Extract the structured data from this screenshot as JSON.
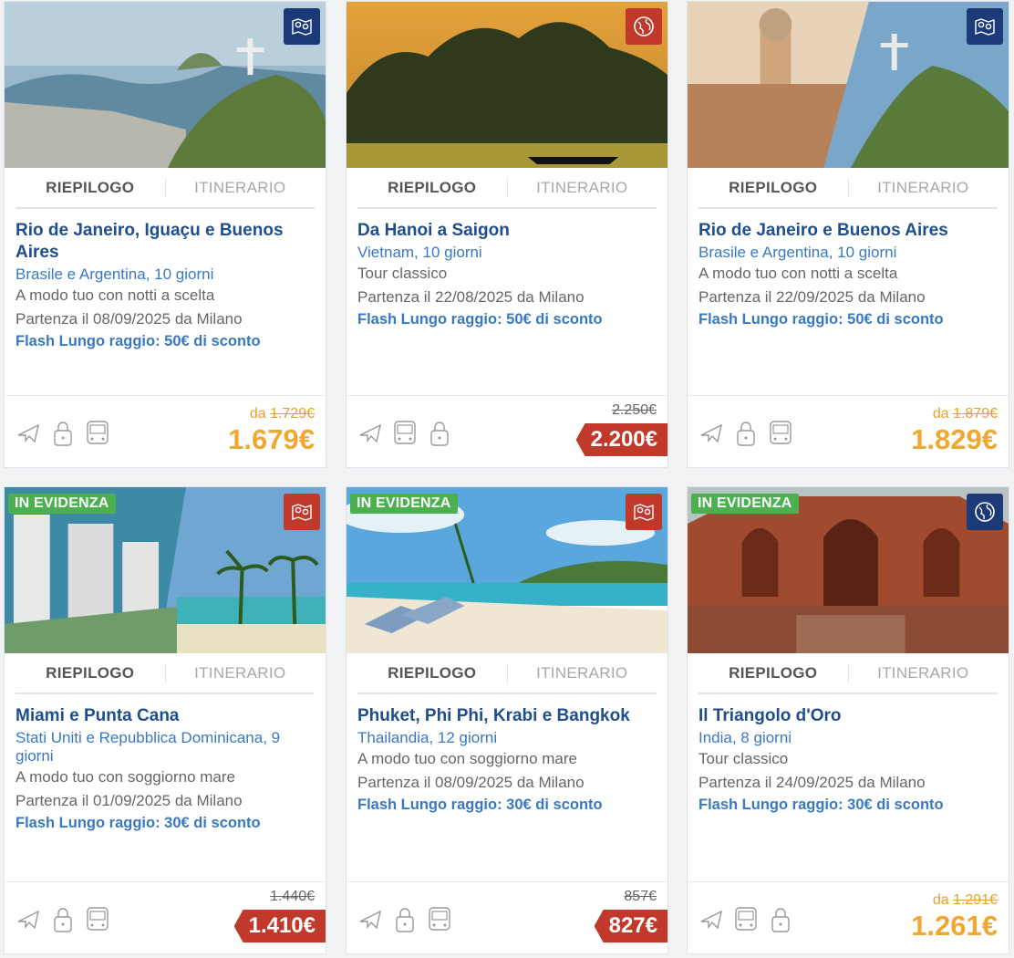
{
  "tabs": {
    "summary": "RIEPILOGO",
    "itinerary": "ITINERARIO"
  },
  "featured_label": "IN EVIDENZA",
  "cards": [
    {
      "title": "Rio de Janeiro, Iguaçu e Buenos Aires",
      "destination": "Brasile e Argentina, 10 giorni",
      "formula": "A modo tuo con notti a scelta",
      "departure": "Partenza il 08/09/2025 da Milano",
      "promo": "Flash Lungo raggio: 50€ di sconto",
      "da_label": "da",
      "old_price": "1.729€",
      "price": "1.679€",
      "price_style": "orange",
      "badge_icon": "map-pin-icon",
      "badge_color": "#1d3a78",
      "services": [
        "plane-icon",
        "lock-icon",
        "bus-icon"
      ]
    },
    {
      "title": "Da Hanoi a Saigon",
      "destination": "Vietnam, 10 giorni",
      "formula": "Tour classico",
      "departure": "Partenza il 22/08/2025 da Milano",
      "promo": "Flash Lungo raggio: 50€ di sconto",
      "old_price": "2.250€",
      "price": "2.200€",
      "price_style": "red",
      "badge_icon": "globe-icon",
      "badge_color": "#c0392b",
      "services": [
        "plane-icon",
        "bus-icon",
        "lock-icon"
      ]
    },
    {
      "title": "Rio de Janeiro e Buenos Aires",
      "destination": "Brasile e Argentina, 10 giorni",
      "formula": "A modo tuo con notti a scelta",
      "departure": "Partenza il 22/09/2025 da Milano",
      "promo": "Flash Lungo raggio: 50€ di sconto",
      "da_label": "da",
      "old_price": "1.879€",
      "price": "1.829€",
      "price_style": "orange",
      "badge_icon": "map-pin-icon",
      "badge_color": "#1d3a78",
      "services": [
        "plane-icon",
        "lock-icon",
        "bus-icon"
      ]
    },
    {
      "title": "Miami e Punta Cana",
      "destination": "Stati Uniti e Repubblica Dominicana, 9 giorni",
      "formula": "A modo tuo con soggiorno mare",
      "departure": "Partenza il 01/09/2025 da Milano",
      "promo": "Flash Lungo raggio: 30€ di sconto",
      "old_price": "1.440€",
      "price": "1.410€",
      "price_style": "red",
      "badge_icon": "map-pin-icon",
      "badge_color": "#c0392b",
      "services": [
        "plane-icon",
        "lock-icon",
        "bus-icon"
      ]
    },
    {
      "title": "Phuket, Phi Phi, Krabi e Bangkok",
      "destination": "Thailandia, 12 giorni",
      "formula": "A modo tuo con soggiorno mare",
      "departure": "Partenza il 08/09/2025 da Milano",
      "promo": "Flash Lungo raggio: 30€ di sconto",
      "old_price": "857€",
      "price": "827€",
      "price_style": "red",
      "badge_icon": "map-pin-icon",
      "badge_color": "#c0392b",
      "services": [
        "plane-icon",
        "lock-icon",
        "bus-icon"
      ]
    },
    {
      "title": "Il Triangolo d'Oro",
      "destination": "India, 8 giorni",
      "formula": "Tour classico",
      "departure": "Partenza il 24/09/2025 da Milano",
      "promo": "Flash Lungo raggio: 30€ di sconto",
      "da_label": "da",
      "old_price": "1.291€",
      "price": "1.261€",
      "price_style": "orange",
      "badge_icon": "globe-icon",
      "badge_color": "#1d3a78",
      "services": [
        "plane-icon",
        "bus-icon",
        "lock-icon"
      ]
    }
  ]
}
